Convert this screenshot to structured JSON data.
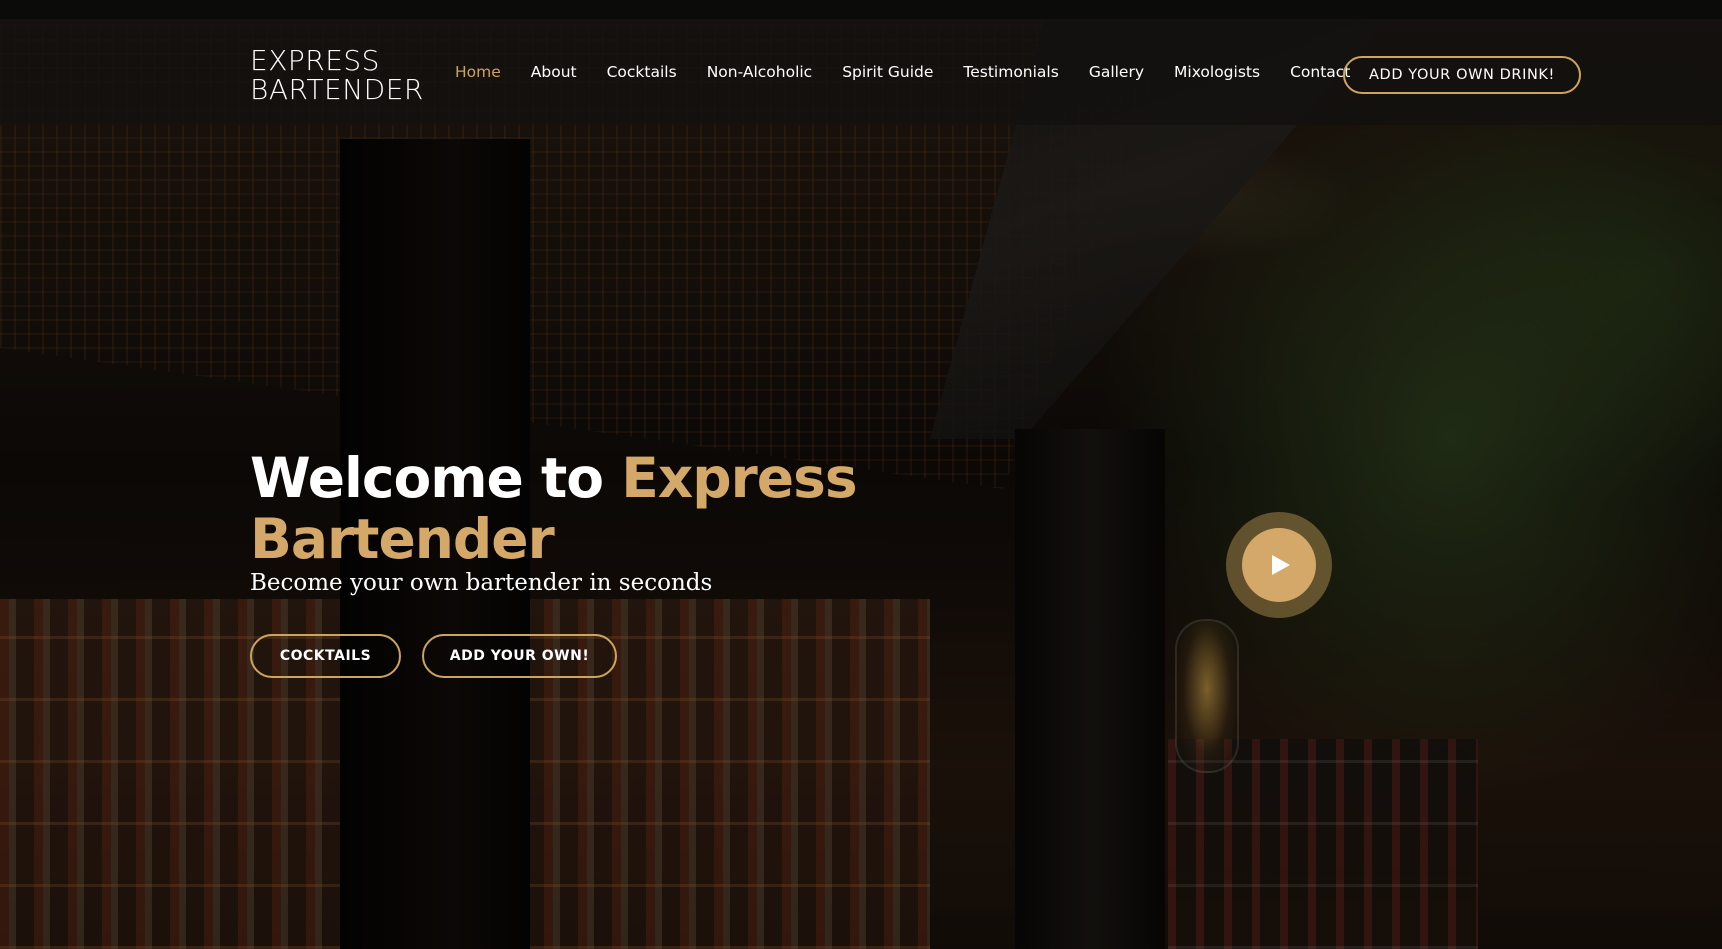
{
  "header": {
    "logo_line1": "EXPRESS",
    "logo_line2": "BARTENDER",
    "nav": [
      {
        "label": "Home",
        "active": true
      },
      {
        "label": "About"
      },
      {
        "label": "Cocktails"
      },
      {
        "label": "Non-Alcoholic"
      },
      {
        "label": "Spirit Guide"
      },
      {
        "label": "Testimonials"
      },
      {
        "label": "Gallery"
      },
      {
        "label": "Mixologists"
      },
      {
        "label": "Contact"
      }
    ],
    "cta_label": "ADD YOUR OWN DRINK!"
  },
  "hero": {
    "headline_prefix": "Welcome to ",
    "headline_accent": "Express Bartender",
    "subtitle": "Become your own bartender in seconds",
    "buttons": [
      {
        "label": "COCKTAILS"
      },
      {
        "label": "ADD YOUR OWN!"
      }
    ],
    "play_icon": "play-icon"
  },
  "colors": {
    "accent": "#cda45e",
    "header_bg": "#12110f",
    "text": "#ffffff"
  }
}
